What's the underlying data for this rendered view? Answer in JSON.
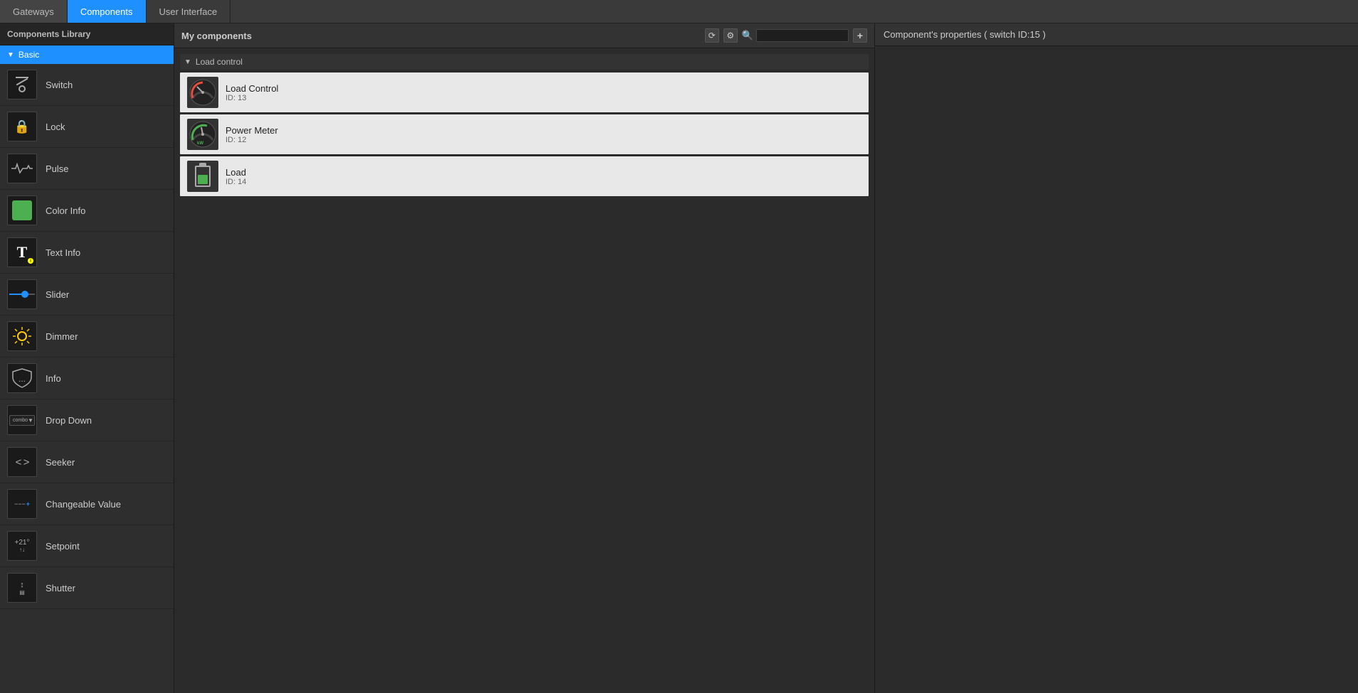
{
  "topNav": {
    "tabs": [
      {
        "id": "gateways",
        "label": "Gateways",
        "active": false
      },
      {
        "id": "components",
        "label": "Components",
        "active": true
      },
      {
        "id": "user-interface",
        "label": "User Interface",
        "active": false
      }
    ]
  },
  "sidebar": {
    "header": "Components Library",
    "category": "Basic",
    "items": [
      {
        "id": "switch",
        "label": "Switch",
        "icon": "switch"
      },
      {
        "id": "lock",
        "label": "Lock",
        "icon": "lock"
      },
      {
        "id": "pulse",
        "label": "Pulse",
        "icon": "pulse"
      },
      {
        "id": "color-info",
        "label": "Color Info",
        "icon": "color-info"
      },
      {
        "id": "text-info",
        "label": "Text Info",
        "icon": "text-info"
      },
      {
        "id": "slider",
        "label": "Slider",
        "icon": "slider"
      },
      {
        "id": "dimmer",
        "label": "Dimmer",
        "icon": "dimmer"
      },
      {
        "id": "info",
        "label": "Info",
        "icon": "info"
      },
      {
        "id": "drop-down",
        "label": "Drop Down",
        "icon": "drop-down"
      },
      {
        "id": "seeker",
        "label": "Seeker",
        "icon": "seeker"
      },
      {
        "id": "changeable-value",
        "label": "Changeable Value",
        "icon": "changeable-value"
      },
      {
        "id": "setpoint",
        "label": "Setpoint",
        "icon": "setpoint"
      },
      {
        "id": "shutter",
        "label": "Shutter",
        "icon": "shutter"
      }
    ]
  },
  "middlePanel": {
    "title": "My components",
    "searchPlaceholder": "",
    "groups": [
      {
        "label": "Load control",
        "collapsed": false,
        "items": [
          {
            "id": "13",
            "name": "Load Control",
            "idLabel": "ID: 13",
            "icon": "gauge"
          },
          {
            "id": "12",
            "name": "Power Meter",
            "idLabel": "ID: 12",
            "icon": "kw"
          },
          {
            "id": "14",
            "name": "Load",
            "idLabel": "ID: 14",
            "icon": "battery"
          }
        ]
      }
    ]
  },
  "rightPanel": {
    "header": "Component's properties ( switch ID:15 )"
  }
}
